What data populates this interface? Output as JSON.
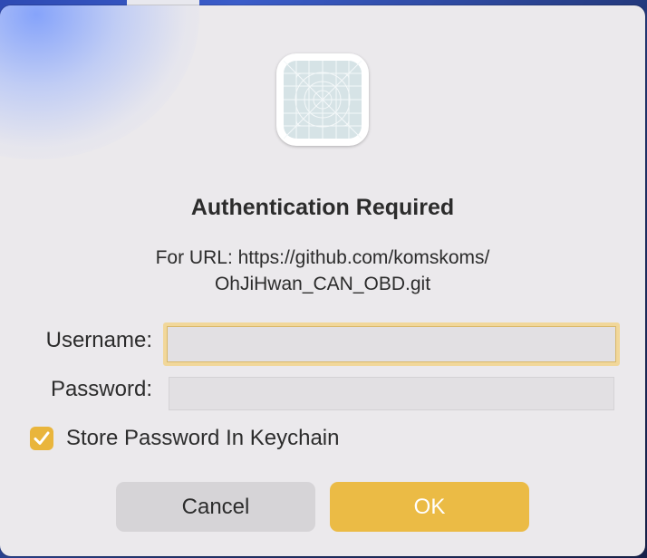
{
  "dialog": {
    "title": "Authentication Required",
    "url_line1": "For URL: https://github.com/komskoms/",
    "url_line2": "OhJiHwan_CAN_OBD.git",
    "app_icon": "app-placeholder-icon"
  },
  "form": {
    "username_label": "Username:",
    "username_value": "",
    "password_label": "Password:",
    "password_value": "",
    "store_password_label": "Store Password In Keychain",
    "store_password_checked": true
  },
  "buttons": {
    "cancel_label": "Cancel",
    "ok_label": "OK"
  },
  "colors": {
    "accent": "#ebbb45",
    "focus_ring": "#f1d79a",
    "dialog_bg": "#ebe9ec"
  }
}
